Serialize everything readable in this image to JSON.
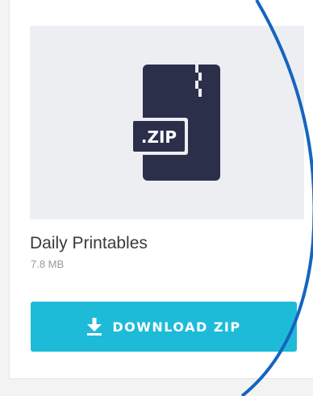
{
  "file": {
    "title": "Daily Printables",
    "size": "7.8 MB",
    "type_badge": ".ZIP"
  },
  "actions": {
    "download_label": "DOWNLOAD ZIP"
  },
  "icons": {
    "file": "zip-file-icon",
    "download": "download-icon"
  },
  "colors": {
    "button": "#1ebbd9",
    "file_icon": "#2b2f4a",
    "accent_arc": "#1565c0"
  }
}
